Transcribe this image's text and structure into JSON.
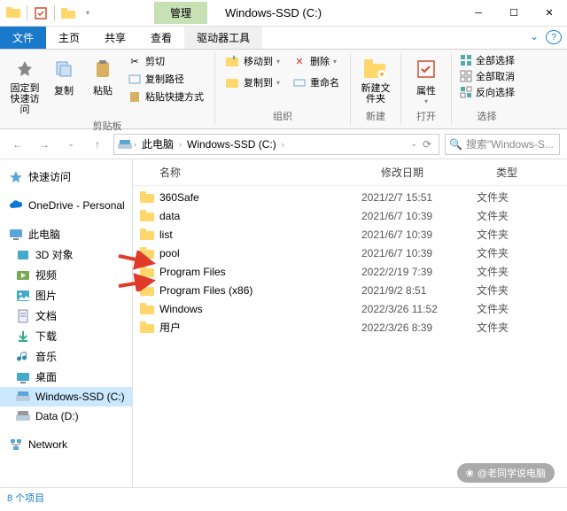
{
  "window": {
    "title": "Windows-SSD (C:)",
    "context_tab": "管理"
  },
  "tabs": {
    "file": "文件",
    "home": "主页",
    "share": "共享",
    "view": "查看",
    "drive": "驱动器工具"
  },
  "ribbon": {
    "clipboard": {
      "label": "剪贴板",
      "pin": "固定到快速访问",
      "copy": "复制",
      "paste": "粘贴",
      "cut": "剪切",
      "copy_path": "复制路径",
      "paste_shortcut": "粘贴快捷方式"
    },
    "organize": {
      "label": "组织",
      "move_to": "移动到",
      "copy_to": "复制到",
      "delete": "删除",
      "rename": "重命名"
    },
    "new": {
      "label": "新建",
      "new_folder": "新建文件夹"
    },
    "open": {
      "label": "打开",
      "properties": "属性"
    },
    "select": {
      "label": "选择",
      "select_all": "全部选择",
      "select_none": "全部取消",
      "invert": "反向选择"
    }
  },
  "breadcrumb": {
    "this_pc": "此电脑",
    "drive": "Windows-SSD (C:)"
  },
  "search": {
    "placeholder": "搜索\"Windows-S..."
  },
  "sidebar": {
    "quick": "快速访问",
    "onedrive": "OneDrive - Personal",
    "this_pc": "此电脑",
    "items": [
      "3D 对象",
      "视频",
      "图片",
      "文档",
      "下载",
      "音乐",
      "桌面",
      "Windows-SSD (C:)",
      "Data (D:)"
    ],
    "network": "Network"
  },
  "columns": {
    "name": "名称",
    "date": "修改日期",
    "type": "类型"
  },
  "files": [
    {
      "name": "360Safe",
      "date": "2021/2/7 15:51",
      "type": "文件夹"
    },
    {
      "name": "data",
      "date": "2021/6/7 10:39",
      "type": "文件夹"
    },
    {
      "name": "list",
      "date": "2021/6/7 10:39",
      "type": "文件夹"
    },
    {
      "name": "pool",
      "date": "2021/6/7 10:39",
      "type": "文件夹"
    },
    {
      "name": "Program Files",
      "date": "2022/2/19 7:39",
      "type": "文件夹"
    },
    {
      "name": "Program Files (x86)",
      "date": "2021/9/2 8:51",
      "type": "文件夹"
    },
    {
      "name": "Windows",
      "date": "2022/3/26 11:52",
      "type": "文件夹"
    },
    {
      "name": "用户",
      "date": "2022/3/26 8:39",
      "type": "文件夹"
    }
  ],
  "status": {
    "count": "8 个项目"
  },
  "watermark": "@老同学说电脑"
}
